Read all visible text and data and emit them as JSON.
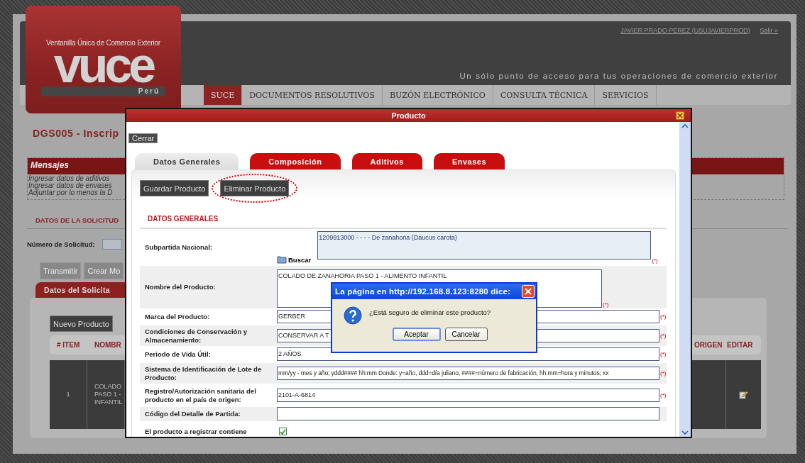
{
  "header": {
    "logo": {
      "tagline": "Ventanilla Única de Comercio Exterior",
      "wordmark": "vuce",
      "country": "Perú"
    },
    "user_link": "JAVIER PRADO PEREZ (USUJAVIERPROD)",
    "logout_link": "Salir »",
    "slogan": "Un sólo punto de acceso para tus operaciones de comercio exterior"
  },
  "nav": [
    {
      "label": "SUCE",
      "selected": true
    },
    {
      "label": "DOCUMENTOS RESOLUTIVOS",
      "selected": false
    },
    {
      "label": "BUZÓN ELECTRÓNICO",
      "selected": false
    },
    {
      "label": "CONSULTA TÉCNICA",
      "selected": false
    },
    {
      "label": "SERVICIOS",
      "selected": false
    }
  ],
  "page": {
    "title": "DGS005 - Inscrip",
    "messages": {
      "title": "Mensajes",
      "lines": [
        "Ingresar datos de aditivos",
        "Ingresar datos de envases",
        "Adjuntar por lo menos la D"
      ]
    },
    "section": "DATOS DE LA SOLICITUD",
    "request_label": "Número de Solicitud:",
    "actions": [
      {
        "label": "Transmitir",
        "disabled": true
      },
      {
        "label": "Crear Mo",
        "disabled": true
      }
    ],
    "tab": "Datos del Solicita",
    "new_button": "Nuevo Producto",
    "table": {
      "columns_left": [
        "# ITEM",
        "NOMBR"
      ],
      "columns_right": [
        "ORIGEN",
        "EDITAR"
      ],
      "rows": [
        {
          "item": "1",
          "name_lines": [
            "COLADO",
            "PASO 1 -",
            "INFANTIL"
          ]
        }
      ]
    }
  },
  "modal": {
    "title": "Producto",
    "close_button": "Cerrar",
    "tabs": [
      {
        "label": "Datos Generales",
        "selected": true
      },
      {
        "label": "Composición",
        "selected": false
      },
      {
        "label": "Aditivos",
        "selected": false
      },
      {
        "label": "Envases",
        "selected": false
      }
    ],
    "actions": [
      {
        "label": "Guardar Producto",
        "highlighted": false
      },
      {
        "label": "Eliminar Producto",
        "highlighted": true
      }
    ],
    "section": "DATOS GENERALES",
    "fields": [
      {
        "kind": "lookup",
        "label": "Subpartida Nacional:",
        "value": "1209913000 - - - - De zanahoria (Daucus carota)",
        "button": "Buscar",
        "note": "(*)"
      },
      {
        "kind": "textarea",
        "label": "Nombre del Producto:",
        "value": "COLADO DE ZANAHORIA PASO 1 - ALIMENTO INFANTIL",
        "note": "(*)"
      },
      {
        "kind": "text",
        "label": "Marca del Producto:",
        "value": "GERBER",
        "note": "(*)"
      },
      {
        "kind": "text",
        "label": "Condiciones de Conservación y Almacenamiento:",
        "value": "CONSERVAR A T",
        "note": "(*)"
      },
      {
        "kind": "text",
        "label": "Periodo de Vida Útil:",
        "value": "2 AÑOS",
        "note": "(*)"
      },
      {
        "kind": "text",
        "label": "Sistema de Identificación de Lote de Producto:",
        "value": "mm/yy - mes y año; yddd#### hh:mm Donde: y=año, ddd=día juliano, ####=número de fabricación, hh:mm=hora y minutos; xx",
        "note": "(*)",
        "small": true
      },
      {
        "kind": "text",
        "label": "Registro/Autorización sanitaria del producto en el país de origen:",
        "value": "2101-A-6814",
        "note": "(*)"
      },
      {
        "kind": "text",
        "label": "Código del Detalle de Partida:"
      },
      {
        "kind": "checkbox",
        "label": "El producto a registrar contiene",
        "checked": true
      }
    ]
  },
  "alert": {
    "title": "La página en http://192.168.8.123:8280 dice:",
    "message": "¿Está seguro de eliminar este producto?",
    "buttons": [
      {
        "label": "Aceptar",
        "selected": true
      },
      {
        "label": "Cancelar",
        "selected": false
      }
    ]
  }
}
